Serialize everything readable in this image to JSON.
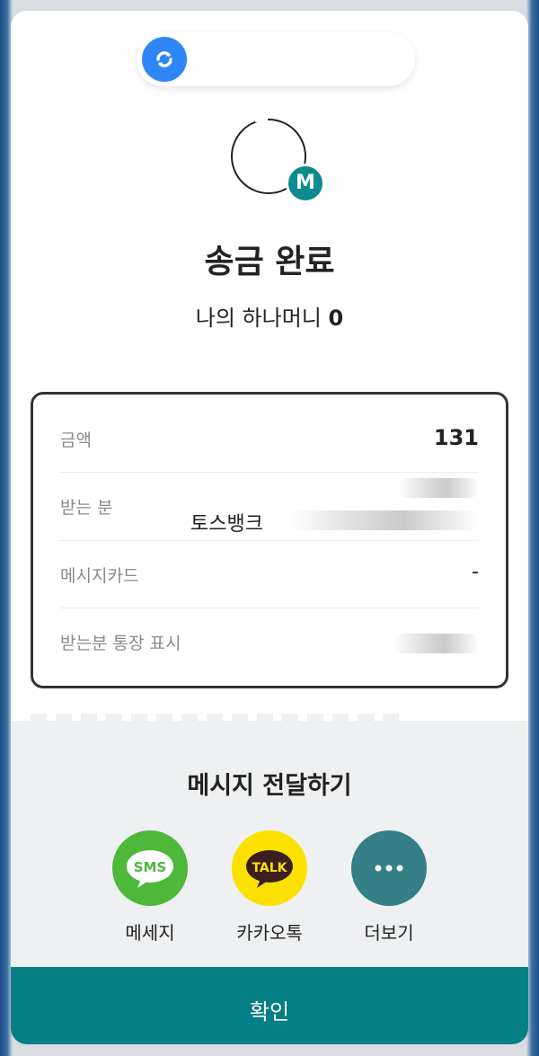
{
  "header": {
    "logo_icon": "toss-logo-icon"
  },
  "profile": {
    "badge_letter": "M"
  },
  "title": "송금 완료",
  "balance": {
    "label": "나의 하나머니",
    "value": "0"
  },
  "details": {
    "rows": [
      {
        "label": "금액",
        "value": "131"
      },
      {
        "label": "받는 분",
        "value": ""
      },
      {
        "label": "메시지카드",
        "value": "-"
      },
      {
        "label": "받는분 통장 표시",
        "value": ""
      }
    ],
    "bank_name": "토스뱅크"
  },
  "share": {
    "title": "메시지 전달하기",
    "buttons": [
      {
        "label": "메세지",
        "icon": "sms-icon",
        "icon_text": "SMS",
        "color": "#4db83a"
      },
      {
        "label": "카카오톡",
        "icon": "kakaotalk-icon",
        "icon_text": "TALK",
        "color": "#fce100"
      },
      {
        "label": "더보기",
        "icon": "more-icon",
        "icon_text": "···",
        "color": "#357f86"
      }
    ]
  },
  "confirm": {
    "label": "확인",
    "color": "#047f85"
  }
}
